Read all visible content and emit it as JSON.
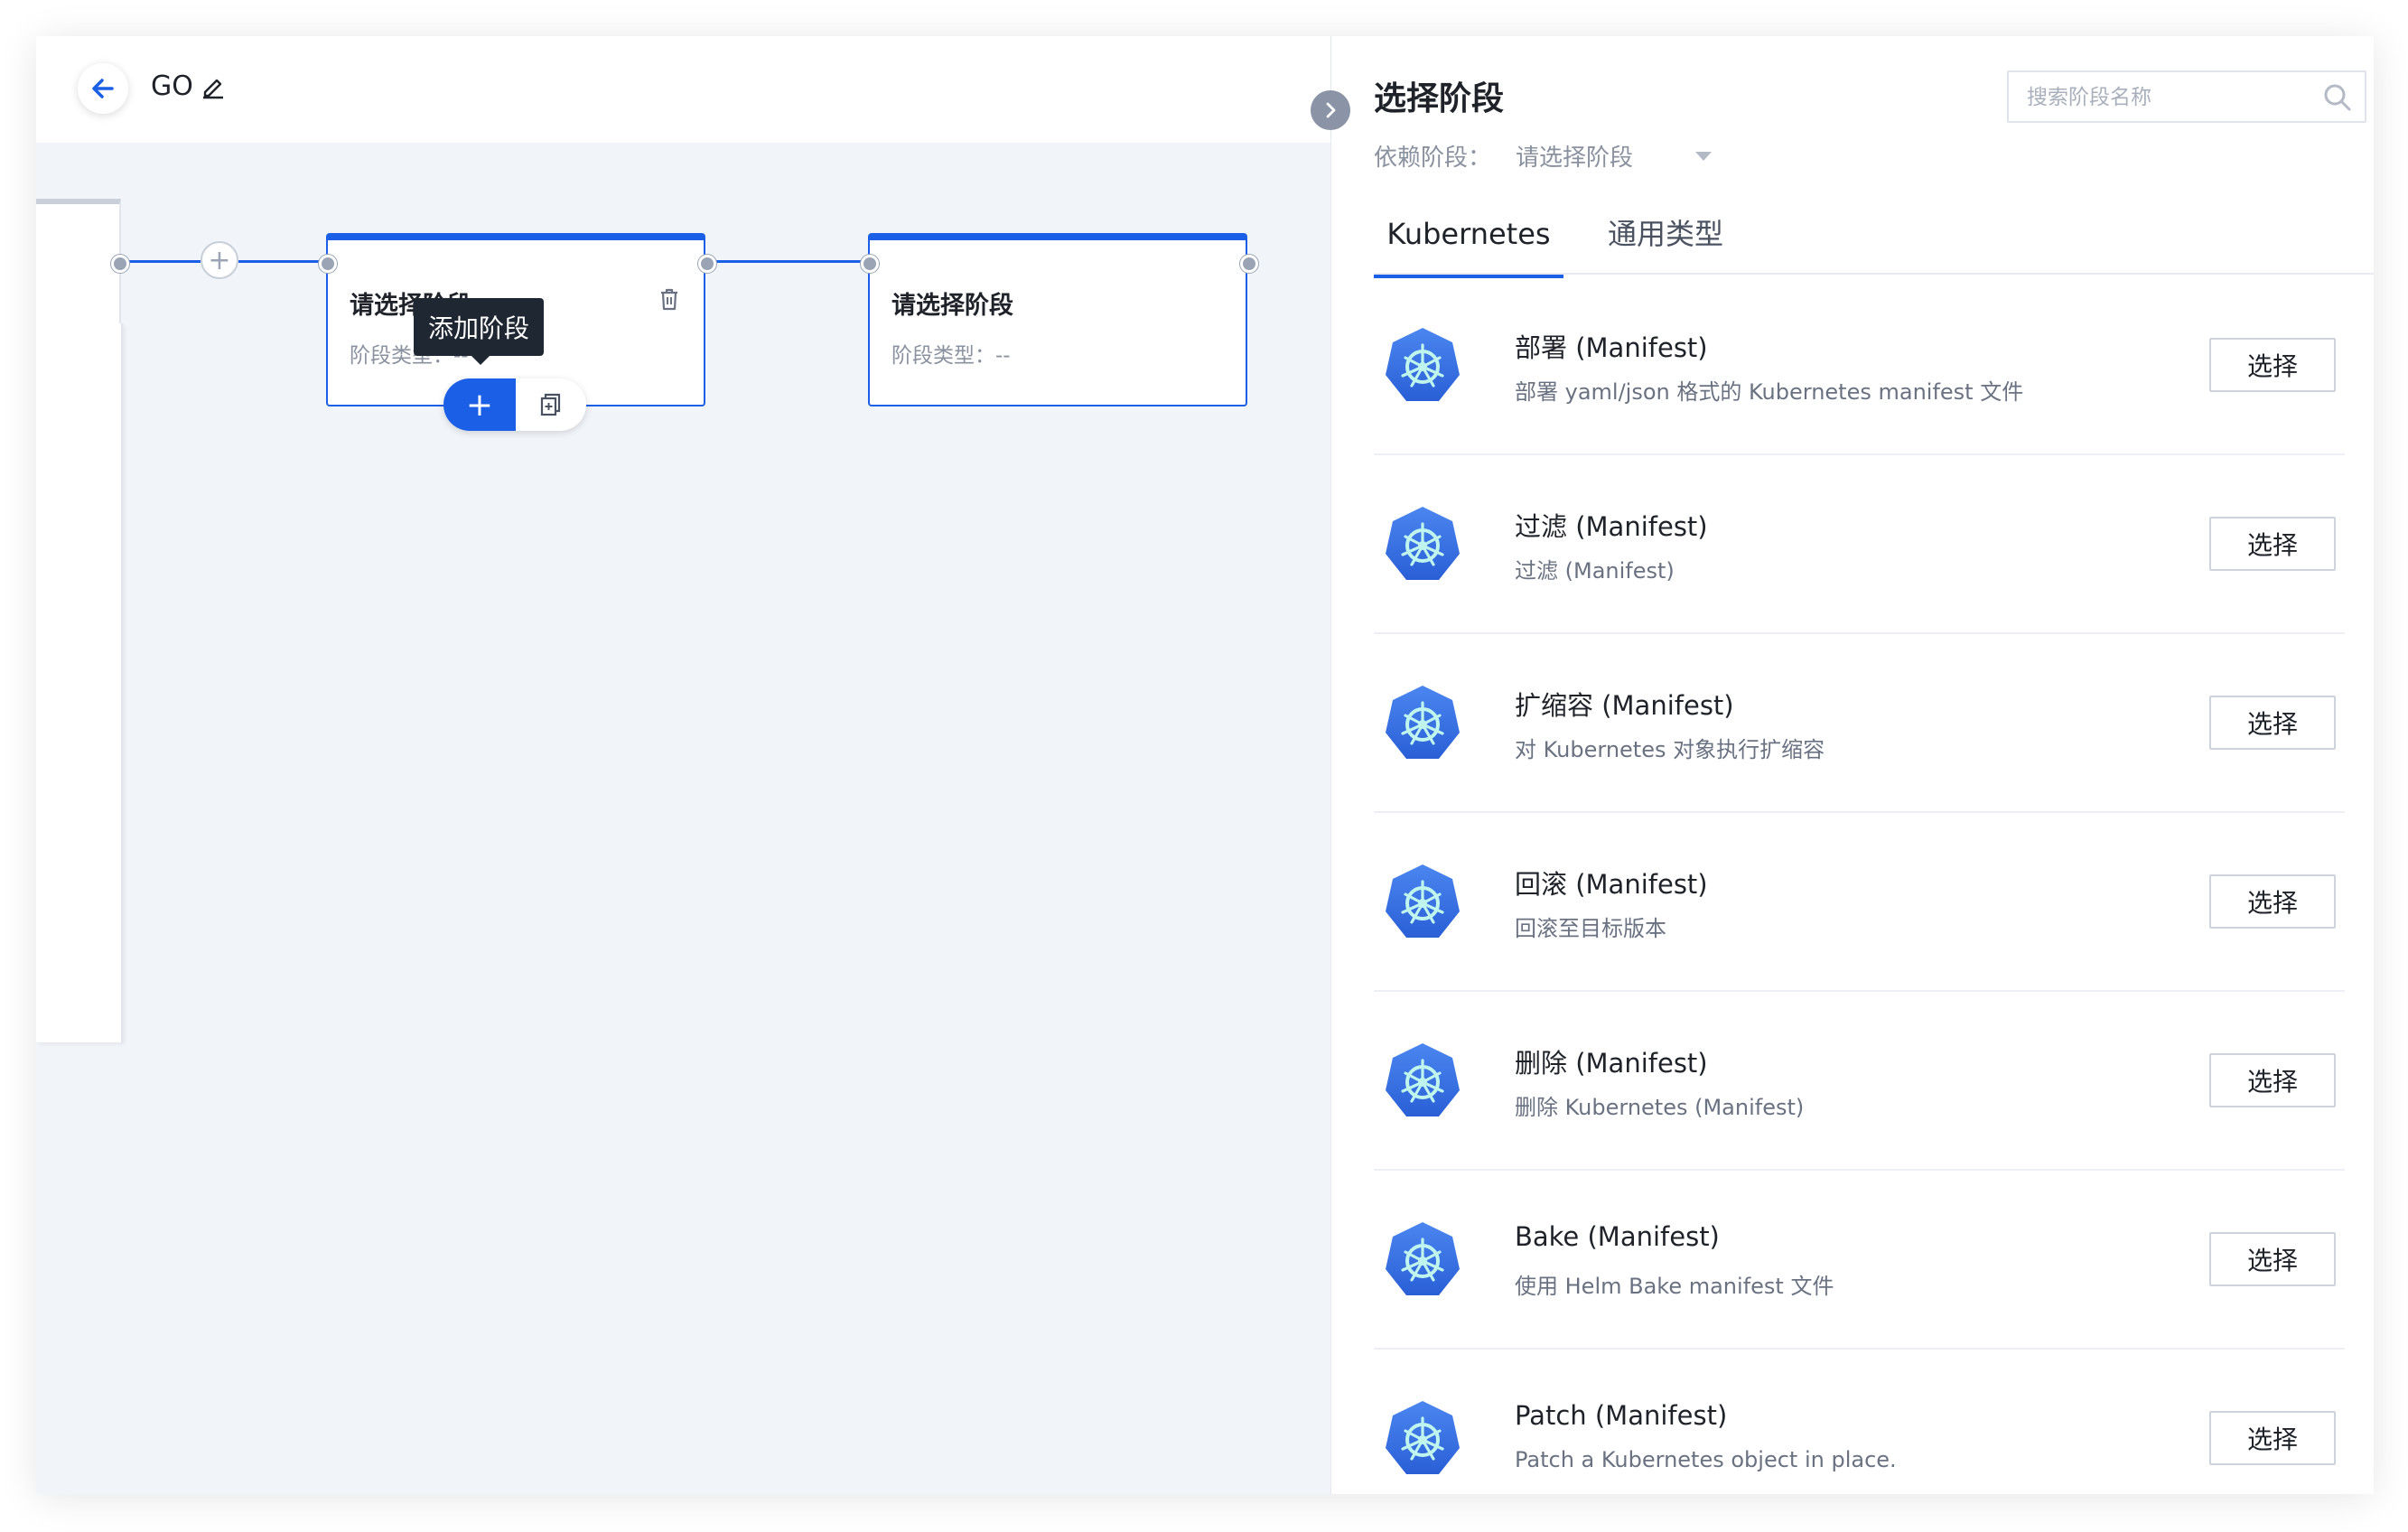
{
  "header": {
    "title": "GO"
  },
  "pipeline": {
    "add_circle_label": "+",
    "stage1": {
      "title": "请选择阶段",
      "subtitle": "阶段类型：--"
    },
    "stage2": {
      "title": "请选择阶段",
      "subtitle": "阶段类型：--"
    },
    "tooltip": "添加阶段",
    "add_button_label": "+"
  },
  "panel": {
    "title": "选择阶段",
    "search_placeholder": "搜索阶段名称",
    "dependency_label": "依赖阶段：",
    "dependency_value": "请选择阶段",
    "tabs": [
      {
        "label": "Kubernetes",
        "active": true
      },
      {
        "label": "通用类型",
        "active": false
      }
    ],
    "items": [
      {
        "name": "部署 (Manifest)",
        "desc": "部署 yaml/json 格式的 Kubernetes manifest 文件",
        "button": "选择",
        "icon": "kubernetes-icon"
      },
      {
        "name": "过滤 (Manifest)",
        "desc": "过滤 (Manifest)",
        "button": "选择",
        "icon": "kubernetes-icon"
      },
      {
        "name": "扩缩容 (Manifest)",
        "desc": "对 Kubernetes 对象执行扩缩容",
        "button": "选择",
        "icon": "kubernetes-icon"
      },
      {
        "name": "回滚 (Manifest)",
        "desc": "回滚至目标版本",
        "button": "选择",
        "icon": "kubernetes-icon"
      },
      {
        "name": "删除 (Manifest)",
        "desc": "删除 Kubernetes (Manifest)",
        "button": "选择",
        "icon": "kubernetes-icon"
      },
      {
        "name": "Bake (Manifest)",
        "desc": "使用 Helm Bake manifest 文件",
        "button": "选择",
        "icon": "kubernetes-icon"
      },
      {
        "name": "Patch (Manifest)",
        "desc": "Patch a Kubernetes object in place.",
        "button": "选择",
        "icon": "kubernetes-icon"
      }
    ]
  },
  "colors": {
    "primary": "#1b5fe6",
    "canvas_bg": "#f1f4f9",
    "k8s_blue": "#326ce5"
  }
}
